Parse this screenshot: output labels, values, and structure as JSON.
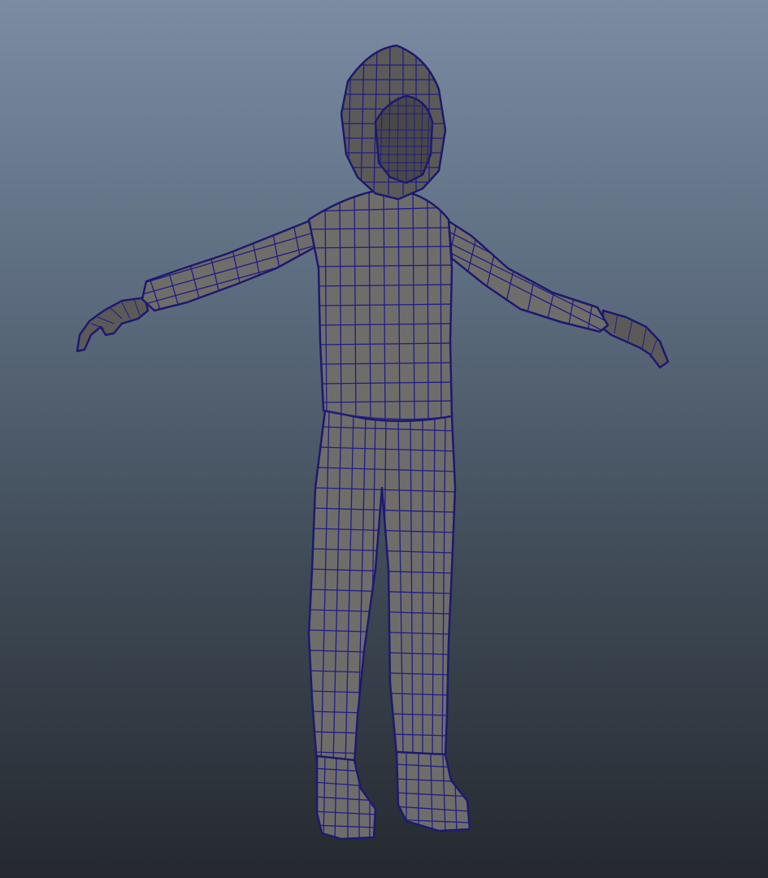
{
  "viewport": {
    "background_top": "#7b8ca3",
    "background_bottom": "#25292f",
    "mesh_color": "#6f6d6a",
    "wireframe_color": "#1f1c86",
    "display_mode": "wireframe-on-shaded"
  },
  "model": {
    "pose": "t-pose",
    "parts": [
      "hood",
      "face",
      "torso",
      "left-arm",
      "right-arm",
      "left-hand",
      "right-hand",
      "left-leg",
      "right-leg",
      "left-shoe",
      "right-shoe"
    ]
  }
}
